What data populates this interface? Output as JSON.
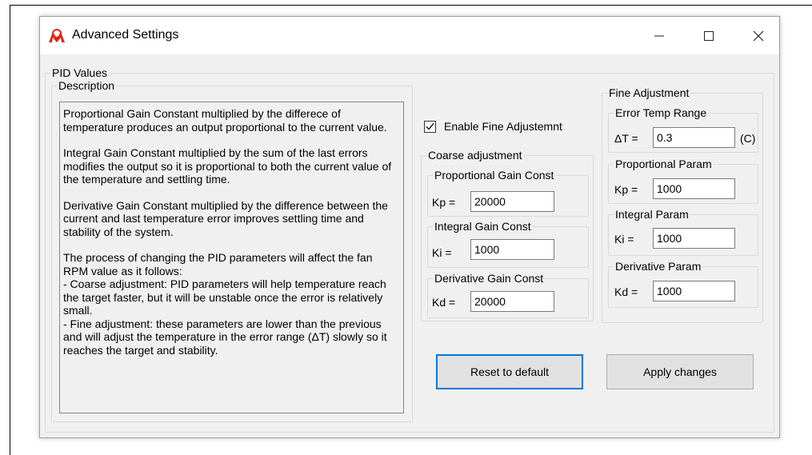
{
  "window": {
    "title": "Advanced Settings",
    "controls": {
      "minimize": "—",
      "maximize": "☐",
      "close": "✕"
    }
  },
  "pid_values": {
    "group_title": "PID Values",
    "description": {
      "group_title": "Description",
      "paragraphs": [
        "Proportional Gain Constant multiplied by the differece of temperature produces an output proportional to the current value.",
        "Integral Gain Constant multiplied by the sum of the last errors modifies the output so it is proportional to both the current value of the temperature and settling time.",
        "Derivative Gain Constant multiplied by the difference between the current and last temperature error improves settling time and stability of the system.",
        "The process of changing the PID parameters will affect the fan RPM value as it follows:\n- Coarse adjustment: PID parameters will help temperature reach the target faster, but it will be unstable once the error is relatively small.\n- Fine adjustment: these parameters are lower than the previous and will adjust the temperature in the error range (ΔT) slowly so it reaches the target and stability."
      ]
    },
    "enable_fine": {
      "label": "Enable Fine Adjustemnt",
      "checked": true
    },
    "coarse": {
      "group_title": "Coarse adjustment",
      "proportional": {
        "title": "Proportional Gain Const",
        "label": "Kp =",
        "value": "20000"
      },
      "integral": {
        "title": "Integral Gain Const",
        "label": "Ki =",
        "value": "1000"
      },
      "derivative": {
        "title": "Derivative Gain Const",
        "label": "Kd =",
        "value": "20000"
      }
    },
    "fine": {
      "group_title": "Fine Adjustment",
      "error_range": {
        "title": "Error Temp Range",
        "label": "ΔT =",
        "value": "0.3",
        "unit": "(C)"
      },
      "proportional": {
        "title": "Proportional Param",
        "label": "Kp =",
        "value": "1000"
      },
      "integral": {
        "title": "Integral Param",
        "label": "Ki =",
        "value": "1000"
      },
      "derivative": {
        "title": "Derivative Param",
        "label": "Kd =",
        "value": "1000"
      }
    }
  },
  "buttons": {
    "reset": "Reset to default",
    "apply": "Apply changes"
  },
  "colors": {
    "dialog_background": "#f0f0f0",
    "focus_border": "#0078d7",
    "icon_red": "#e2231a"
  }
}
